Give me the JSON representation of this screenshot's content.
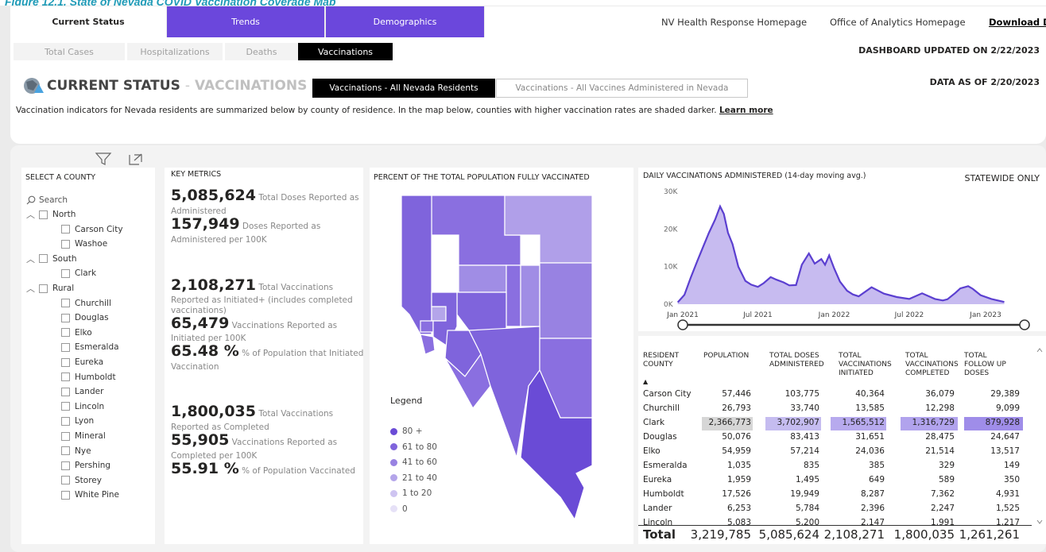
{
  "figure_caption": "Figure 12.1. State of Nevada COVID Vaccination Coverage Map",
  "top_tabs": {
    "current_status": "Current Status",
    "trends": "Trends",
    "demographics": "Demographics"
  },
  "top_links": {
    "nv_health": "NV Health Response Homepage",
    "analytics": "Office of Analytics Homepage",
    "download": "Download Dat"
  },
  "sub_tabs": {
    "total_cases": "Total Cases",
    "hospitalizations": "Hospitalizations",
    "deaths": "Deaths",
    "vaccinations": "Vaccinations"
  },
  "dashboard_updated": "DASHBOARD UPDATED ON 2/22/2023",
  "data_as_of": "DATA AS OF 2/20/2023",
  "title": {
    "main": "CURRENT STATUS",
    "separator": "-",
    "sub": "VACCINATIONS"
  },
  "buttons": {
    "residents": "Vaccinations - All Nevada Residents",
    "all_administered": "Vaccinations - All Vaccines Administered in Nevada"
  },
  "description": "Vaccination indicators for Nevada residents are summarized below by county of residence.  In the map below, counties with higher vaccination rates are shaded darker.",
  "learn_more": "Learn more",
  "slicer": {
    "title": "SELECT A COUNTY",
    "search_placeholder": "Search",
    "groups": [
      {
        "label": "North",
        "items": [
          "Carson City",
          "Washoe"
        ]
      },
      {
        "label": "South",
        "items": [
          "Clark"
        ]
      },
      {
        "label": "Rural",
        "items": [
          "Churchill",
          "Douglas",
          "Elko",
          "Esmeralda",
          "Eureka",
          "Humboldt",
          "Lander",
          "Lincoln",
          "Lyon",
          "Mineral",
          "Nye",
          "Pershing",
          "Storey",
          "White Pine"
        ]
      }
    ]
  },
  "key_metrics": {
    "title": "KEY METRICS",
    "total_doses": "5,085,624",
    "total_doses_label_a": "Total Doses Reported as",
    "total_doses_label_b": "Administered",
    "doses_per_100k": "157,949",
    "doses_per_100k_label_a": "Doses Reported as",
    "doses_per_100k_label_b": "Administered per 100K",
    "initiated": "2,108,271",
    "initiated_label_a": "Total Vaccinations",
    "initiated_label_b": "Reported as Initiated+ (includes completed",
    "initiated_label_c": "vaccinations)",
    "initiated_per_100k": "65,479",
    "initiated_per_100k_label_a": "Vaccinations Reported as",
    "initiated_per_100k_label_b": "Initiated per 100K",
    "initiated_pct": "65.48 %",
    "initiated_pct_label_a": "% of Population that Initiated",
    "initiated_pct_label_b": "Vaccination",
    "completed": "1,800,035",
    "completed_label_a": "Total Vaccinations",
    "completed_label_b": "Reported as Completed",
    "completed_per_100k": "55,905",
    "completed_per_100k_label_a": "Vaccinations Reported as",
    "completed_per_100k_label_b": "Completed per 100K",
    "completed_pct": "55.91 %",
    "completed_pct_label": "% of Population Vaccinated"
  },
  "map": {
    "title": "PERCENT OF THE TOTAL POPULATION FULLY VACCINATED",
    "legend_title": "Legend",
    "legend": [
      {
        "label": "80 +",
        "color": "#6a4bd6"
      },
      {
        "label": "61 to 80",
        "color": "#7f64dc"
      },
      {
        "label": "41 to 60",
        "color": "#9882e2"
      },
      {
        "label": "21 to 40",
        "color": "#b4a5ea"
      },
      {
        "label": "1 to 20",
        "color": "#cec4f1"
      },
      {
        "label": "0",
        "color": "#e6e1f7"
      }
    ]
  },
  "daily_chart": {
    "title": "DAILY VACCINATIONS ADMINISTERED (14-day moving avg.)",
    "scope": "STATEWIDE ONLY",
    "y_ticks": [
      "30K",
      "20K",
      "10K",
      "0K"
    ],
    "x_ticks": [
      "Jan 2021",
      "Jul 2021",
      "Jan 2022",
      "Jul 2022",
      "Jan 2023"
    ]
  },
  "chart_data": {
    "type": "area",
    "title": "DAILY VACCINATIONS ADMINISTERED (14-day moving avg.)",
    "ylim": [
      0,
      30000
    ],
    "x": [
      "2020-12-20",
      "2021-01-05",
      "2021-01-20",
      "2021-02-05",
      "2021-02-20",
      "2021-03-05",
      "2021-03-20",
      "2021-04-01",
      "2021-04-10",
      "2021-04-20",
      "2021-05-01",
      "2021-05-15",
      "2021-06-01",
      "2021-06-15",
      "2021-07-01",
      "2021-07-15",
      "2021-08-01",
      "2021-08-15",
      "2021-09-01",
      "2021-09-15",
      "2021-10-01",
      "2021-10-15",
      "2021-11-01",
      "2021-11-15",
      "2021-12-01",
      "2021-12-10",
      "2021-12-20",
      "2022-01-01",
      "2022-01-15",
      "2022-02-01",
      "2022-02-15",
      "2022-03-01",
      "2022-04-01",
      "2022-05-01",
      "2022-06-01",
      "2022-07-01",
      "2022-08-01",
      "2022-09-01",
      "2022-09-20",
      "2022-10-01",
      "2022-10-20",
      "2022-11-01",
      "2022-11-20",
      "2022-12-01",
      "2022-12-20",
      "2023-01-15",
      "2023-02-15"
    ],
    "series": [
      {
        "values": [
          500,
          2500,
          7000,
          11500,
          15500,
          19000,
          22500,
          26000,
          24000,
          19000,
          16000,
          10000,
          6200,
          5200,
          4600,
          5600,
          7200,
          6500,
          5800,
          5000,
          5100,
          10500,
          13500,
          10800,
          12000,
          10500,
          13000,
          9500,
          6000,
          3600,
          2600,
          2100,
          4500,
          2800,
          1900,
          1400,
          2900,
          1400,
          1000,
          1300,
          3000,
          4200,
          4800,
          4100,
          2400,
          1400,
          600
        ]
      }
    ]
  },
  "table": {
    "headers": [
      [
        "RESIDENT",
        "COUNTY"
      ],
      [
        "POPULATION"
      ],
      [
        "TOTAL DOSES",
        "ADMINISTERED"
      ],
      [
        "TOTAL",
        "VACCINATIONS",
        "INITIATED"
      ],
      [
        "TOTAL",
        "VACCINATIONS",
        "COMPLETED"
      ],
      [
        "TOTAL",
        "FOLLOW UP",
        "DOSES"
      ]
    ],
    "rows": [
      [
        "Carson City",
        "57,446",
        "103,775",
        "40,364",
        "36,079",
        "29,389"
      ],
      [
        "Churchill",
        "26,793",
        "33,740",
        "13,585",
        "12,298",
        "9,099"
      ],
      [
        "Clark",
        "2,366,773",
        "3,702,907",
        "1,565,512",
        "1,316,729",
        "879,928"
      ],
      [
        "Douglas",
        "50,076",
        "83,413",
        "31,651",
        "28,475",
        "24,647"
      ],
      [
        "Elko",
        "54,959",
        "57,214",
        "24,036",
        "21,514",
        "13,517"
      ],
      [
        "Esmeralda",
        "1,035",
        "835",
        "385",
        "329",
        "149"
      ],
      [
        "Eureka",
        "1,959",
        "1,495",
        "649",
        "589",
        "350"
      ],
      [
        "Humboldt",
        "17,526",
        "19,949",
        "8,287",
        "7,362",
        "4,931"
      ],
      [
        "Lander",
        "6,253",
        "5,784",
        "2,396",
        "2,247",
        "1,525"
      ],
      [
        "Lincoln",
        "5,083",
        "5,200",
        "2,147",
        "1,991",
        "1,217"
      ]
    ],
    "total": [
      "Total",
      "3,219,785",
      "5,085,624",
      "2,108,271",
      "1,800,035",
      "1,261,261"
    ]
  }
}
